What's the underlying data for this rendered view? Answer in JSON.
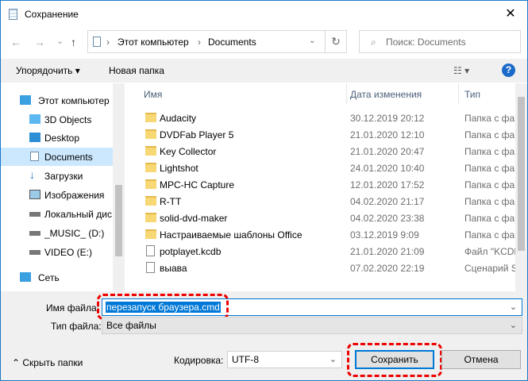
{
  "window": {
    "title": "Сохранение",
    "close": "✕"
  },
  "nav": {
    "back": "←",
    "forward": "→",
    "recent": "⌄",
    "up": "↑",
    "crumbs": [
      "Этот компьютер",
      "Documents"
    ],
    "refresh": "↻",
    "search_placeholder": "Поиск: Documents"
  },
  "toolbar": {
    "organize": "Упорядочить ▾",
    "new_folder": "Новая папка",
    "view": "☷ ▾",
    "help": "?"
  },
  "sidebar": {
    "items": [
      {
        "label": "Этот компьютер",
        "icon": "computer-icon"
      },
      {
        "label": "3D Objects",
        "icon": "cube-icon"
      },
      {
        "label": "Desktop",
        "icon": "desktop-icon"
      },
      {
        "label": "Documents",
        "icon": "documents-icon",
        "selected": true
      },
      {
        "label": "Загрузки",
        "icon": "download-icon"
      },
      {
        "label": "Изображения",
        "icon": "pictures-icon"
      },
      {
        "label": "Локальный дис",
        "icon": "drive-icon"
      },
      {
        "label": "_MUSIC_ (D:)",
        "icon": "drive-icon"
      },
      {
        "label": "VIDEO (E:)",
        "icon": "drive-icon"
      },
      {
        "label": "Сеть",
        "icon": "network-icon"
      }
    ]
  },
  "list": {
    "columns": [
      "Имя",
      "Дата изменения",
      "Тип"
    ],
    "rows": [
      {
        "name": "Audacity",
        "date": "30.12.2019 20:12",
        "type": "Папка с фа",
        "kind": "folder"
      },
      {
        "name": "DVDFab Player 5",
        "date": "21.01.2020 12:10",
        "type": "Папка с фа",
        "kind": "folder"
      },
      {
        "name": "Key Collector",
        "date": "21.01.2020 20:47",
        "type": "Папка с фа",
        "kind": "folder"
      },
      {
        "name": "Lightshot",
        "date": "24.01.2020 10:40",
        "type": "Папка с фа",
        "kind": "folder"
      },
      {
        "name": "MPC-HC Capture",
        "date": "12.01.2020 17:52",
        "type": "Папка с фа",
        "kind": "folder"
      },
      {
        "name": "R-TT",
        "date": "04.02.2020 21:17",
        "type": "Папка с фа",
        "kind": "folder"
      },
      {
        "name": "solid-dvd-maker",
        "date": "04.02.2020 23:38",
        "type": "Папка с фа",
        "kind": "folder"
      },
      {
        "name": "Настраиваемые шаблоны Office",
        "date": "03.12.2019 9:09",
        "type": "Папка с фа",
        "kind": "folder"
      },
      {
        "name": "potplayet.kcdb",
        "date": "21.01.2020 21:09",
        "type": "Файл \"KCDE",
        "kind": "file"
      },
      {
        "name": "выава",
        "date": "07.02.2020 22:19",
        "type": "Сценарий S",
        "kind": "file"
      }
    ]
  },
  "form": {
    "filename_label": "Имя файла:",
    "filename_value": "перезапуск браузера.cmd",
    "filetype_label": "Тип файла:",
    "filetype_value": "Все файлы",
    "encoding_label": "Кодировка:",
    "encoding_value": "UTF-8",
    "hide_folders": "Скрыть папки",
    "save": "Сохранить",
    "cancel": "Отмена"
  },
  "colors": {
    "accent": "#0078d7",
    "highlight": "#e00000",
    "selected": "#cce8ff"
  }
}
